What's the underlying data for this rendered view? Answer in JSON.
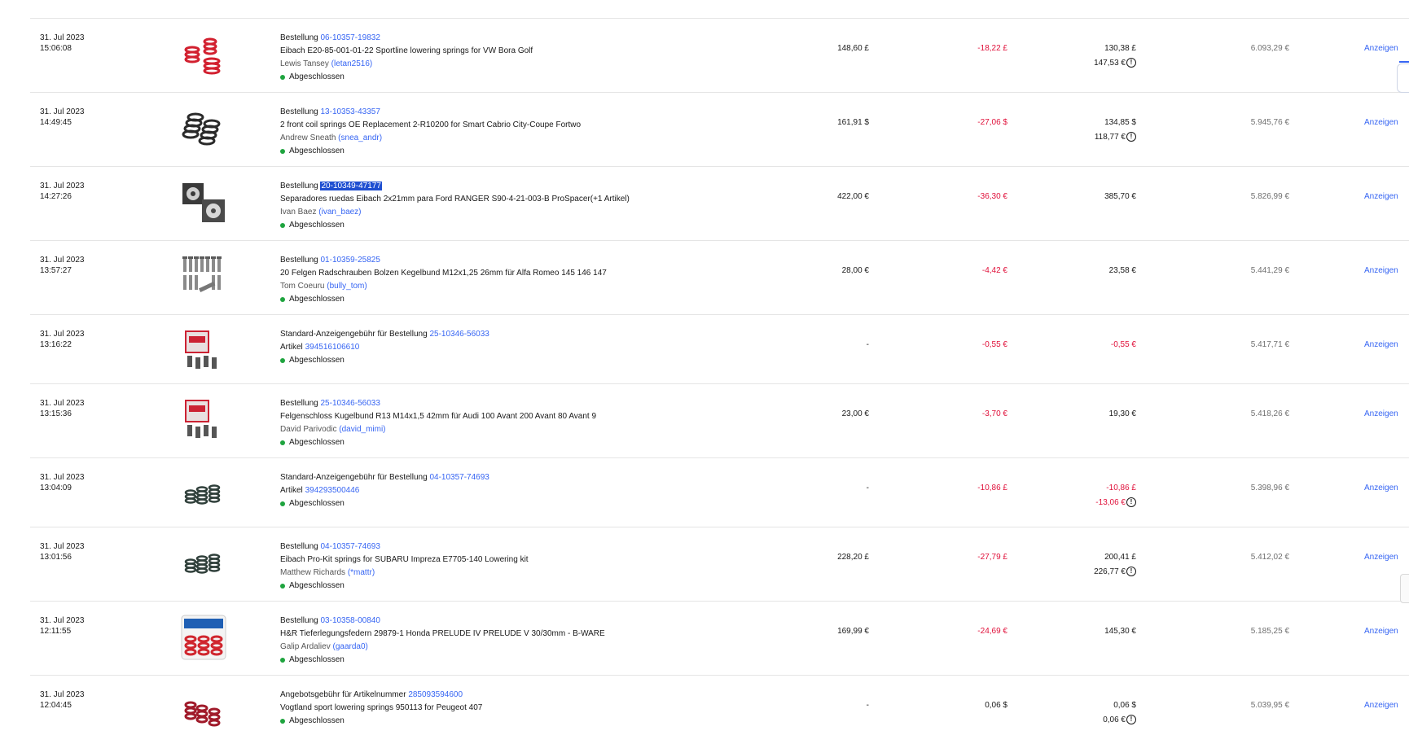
{
  "rows": [
    {
      "date": "31. Jul 2023",
      "time": "15:06:08",
      "prefix": "Bestellung",
      "order": "06-10357-19832",
      "title": "Eibach E20-85-001-01-22 Sportline lowering springs for VW Bora Golf",
      "buyer": "Lewis Tansey",
      "buyer_id": "(letan2516)",
      "status": "Abgeschlossen",
      "amount": "148,60 £",
      "fee": "-18,22 £",
      "net": "130,38 £",
      "net2": "147,53 €",
      "balance": "6.093,29 €",
      "action": "Anzeigen"
    },
    {
      "date": "31. Jul 2023",
      "time": "14:49:45",
      "prefix": "Bestellung",
      "order": "13-10353-43357",
      "title": "2 front coil springs OE Replacement 2-R10200 for Smart Cabrio City-Coupe Fortwo",
      "buyer": "Andrew Sneath",
      "buyer_id": "(snea_andr)",
      "status": "Abgeschlossen",
      "amount": "161,91 $",
      "fee": "-27,06 $",
      "net": "134,85 $",
      "net2": "118,77 €",
      "balance": "5.945,76 €",
      "action": "Anzeigen"
    },
    {
      "date": "31. Jul 2023",
      "time": "14:27:26",
      "prefix": "Bestellung",
      "order": "20-10349-47177",
      "title": "Separadores ruedas Eibach 2x21mm para Ford RANGER S90-4-21-003-B ProSpacer(+1 Artikel)",
      "buyer": "Ivan Baez",
      "buyer_id": "(ivan_baez)",
      "status": "Abgeschlossen",
      "amount": "422,00 €",
      "fee": "-36,30 €",
      "net": "385,70 €",
      "balance": "5.826,99 €",
      "action": "Anzeigen"
    },
    {
      "date": "31. Jul 2023",
      "time": "13:57:27",
      "prefix": "Bestellung",
      "order": "01-10359-25825",
      "title": "20 Felgen Radschrauben Bolzen Kegelbund M12x1,25 26mm für Alfa Romeo 145 146 147",
      "buyer": "Tom Coeuru",
      "buyer_id": "(bully_tom)",
      "status": "Abgeschlossen",
      "amount": "28,00 €",
      "fee": "-4,42 €",
      "net": "23,58 €",
      "balance": "5.441,29 €",
      "action": "Anzeigen"
    },
    {
      "date": "31. Jul 2023",
      "time": "13:16:22",
      "prefix": "Standard-Anzeigengebühr für Bestellung",
      "order": "25-10346-56033",
      "article_label": "Artikel",
      "article": "394516106610",
      "status": "Abgeschlossen",
      "amount": "-",
      "fee": "-0,55 €",
      "net": "-0,55 €",
      "balance": "5.417,71 €",
      "action": "Anzeigen"
    },
    {
      "date": "31. Jul 2023",
      "time": "13:15:36",
      "prefix": "Bestellung",
      "order": "25-10346-56033",
      "title": "Felgenschloss Kugelbund R13 M14x1,5 42mm für Audi 100 Avant 200 Avant 80 Avant 9",
      "buyer": "David Parivodic",
      "buyer_id": "(david_mimi)",
      "status": "Abgeschlossen",
      "amount": "23,00 €",
      "fee": "-3,70 €",
      "net": "19,30 €",
      "balance": "5.418,26 €",
      "action": "Anzeigen"
    },
    {
      "date": "31. Jul 2023",
      "time": "13:04:09",
      "prefix": "Standard-Anzeigengebühr für Bestellung",
      "order": "04-10357-74693",
      "article_label": "Artikel",
      "article": "394293500446",
      "status": "Abgeschlossen",
      "amount": "-",
      "fee": "-10,86 £",
      "net": "-10,86 £",
      "net2": "-13,06 €",
      "balance": "5.398,96 €",
      "action": "Anzeigen"
    },
    {
      "date": "31. Jul 2023",
      "time": "13:01:56",
      "prefix": "Bestellung",
      "order": "04-10357-74693",
      "title": "Eibach Pro-Kit springs for SUBARU Impreza E7705-140 Lowering kit",
      "buyer": "Matthew Richards",
      "buyer_id": "(*mattr)",
      "status": "Abgeschlossen",
      "amount": "228,20 £",
      "fee": "-27,79 £",
      "net": "200,41 £",
      "net2": "226,77 €",
      "balance": "5.412,02 €",
      "action": "Anzeigen"
    },
    {
      "date": "31. Jul 2023",
      "time": "12:11:55",
      "prefix": "Bestellung",
      "order": "03-10358-00840",
      "title": "H&R Tieferlegungsfedern 29879-1 Honda PRELUDE IV PRELUDE V 30/30mm - B-WARE",
      "buyer": "Galip Ardaliev",
      "buyer_id": "(gaarda0)",
      "status": "Abgeschlossen",
      "amount": "169,99 €",
      "fee": "-24,69 €",
      "net": "145,30 €",
      "balance": "5.185,25 €",
      "action": "Anzeigen"
    },
    {
      "date": "31. Jul 2023",
      "time": "12:04:45",
      "prefix": "Angebotsgebühr für Artikelnummer",
      "order": "285093594600",
      "title": "Vogtland sport lowering springs 950113 for Peugeot 407",
      "status": "Abgeschlossen",
      "amount": "-",
      "fee": "0,06 $",
      "net": "0,06 $",
      "net2": "0,06 €",
      "balance": "5.039,95 €",
      "action": "Anzeigen"
    }
  ],
  "info_glyph": "!",
  "colors": {
    "link": "#3665f3",
    "negative": "#e0103a",
    "status_dot": "#1fa43f"
  }
}
